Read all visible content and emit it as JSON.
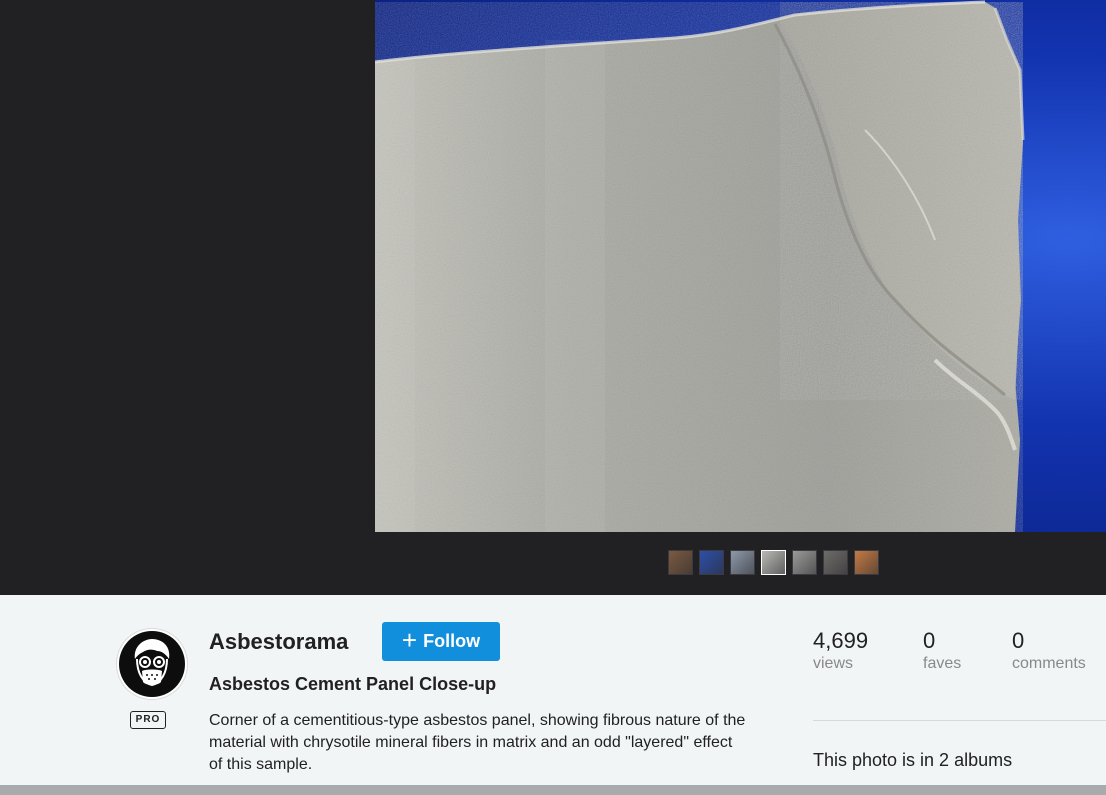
{
  "photo": {
    "alt": "Asbestos Cement Panel Close-up"
  },
  "filmstrip": {
    "thumbs": [
      {
        "icon": "thumb-brown-sample",
        "color": "#7a5a40"
      },
      {
        "icon": "thumb-blue-sample",
        "color": "#2d4fa8"
      },
      {
        "icon": "thumb-gray-blue-sample",
        "color": "#8d98a8"
      },
      {
        "icon": "thumb-current-panel",
        "color": "#b9b9b4"
      },
      {
        "icon": "thumb-gray-sample",
        "color": "#9a9a98"
      },
      {
        "icon": "thumb-fiber-sample",
        "color": "#6e6c68"
      },
      {
        "icon": "thumb-orange-sample",
        "color": "#c47a44"
      }
    ]
  },
  "owner": {
    "name": "Asbestorama",
    "badge": "PRO",
    "avatar_icon": "gas-mask-avatar-icon"
  },
  "follow": {
    "plus": "+",
    "label": "Follow"
  },
  "photo_info": {
    "title": "Asbestos Cement Panel Close-up",
    "description": "Corner of a cementitious-type asbestos panel, showing fibrous nature of the material with chrysotile mineral fibers in matrix and an odd \"layered\" effect of this sample."
  },
  "stats": {
    "views": {
      "value": "4,699",
      "label": "views"
    },
    "faves": {
      "value": "0",
      "label": "faves"
    },
    "comments": {
      "value": "0",
      "label": "comments"
    }
  },
  "albums": {
    "text": "This photo is in 2 albums"
  },
  "colors": {
    "stage_bg": "#212124",
    "panel_bg": "#f2f5f6",
    "accent": "#128fdc"
  }
}
